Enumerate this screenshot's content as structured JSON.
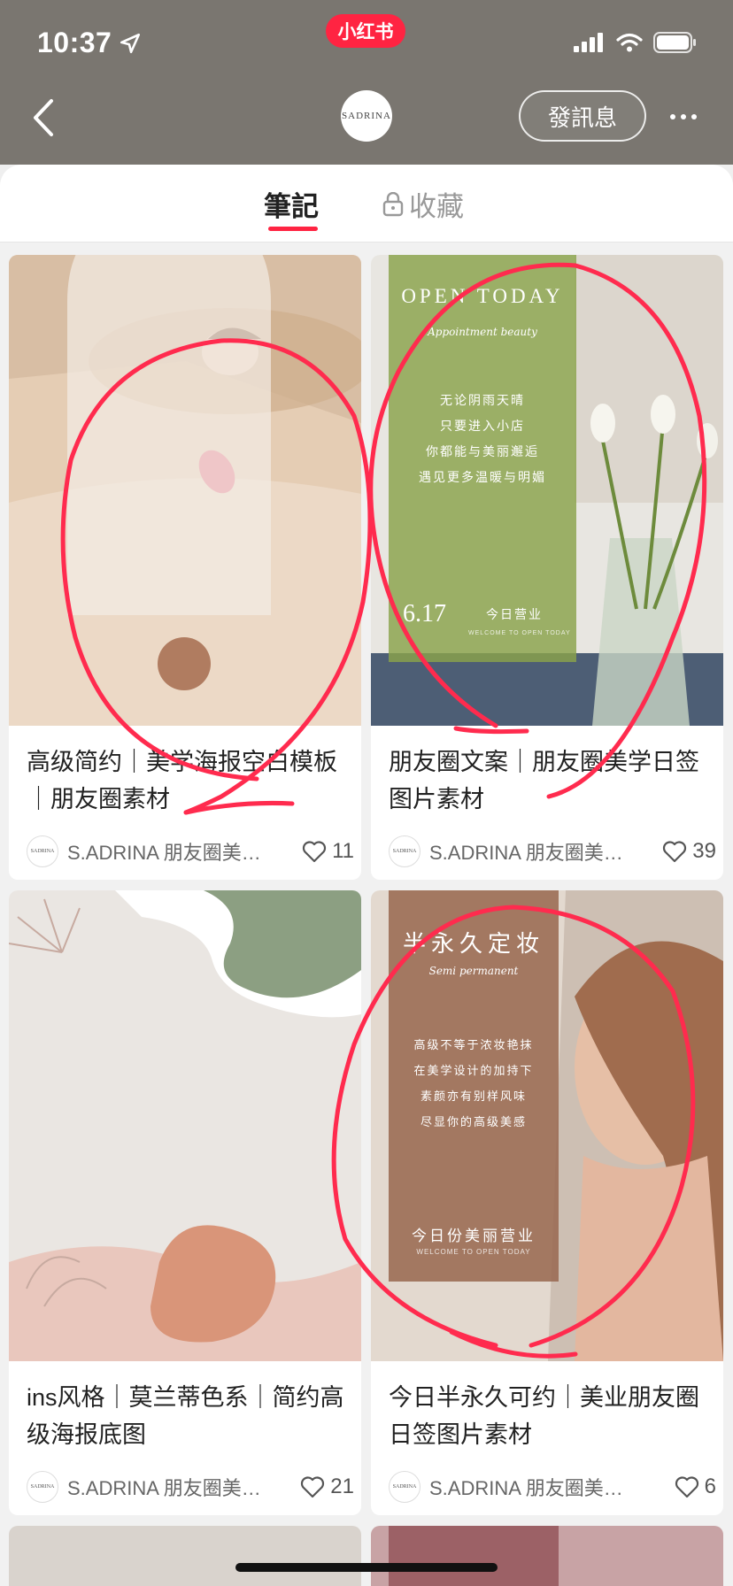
{
  "status": {
    "time": "10:37",
    "app_badge": "小红书"
  },
  "header": {
    "avatar_text": "SADRINA",
    "message_button": "發訊息"
  },
  "tabs": {
    "notes": "筆記",
    "collections": "收藏"
  },
  "cards": [
    {
      "title": "高级简约｜美学海报空白模板｜朋友圈素材",
      "author": "S.ADRINA 朋友圈美…",
      "likes": "11"
    },
    {
      "title": "朋友圈文案｜朋友圈美学日签图片素材",
      "author": "S.ADRINA 朋友圈美…",
      "likes": "39",
      "image_text": {
        "heading": "OPEN TODAY",
        "script": "Appointment beauty",
        "lines": [
          "无论阴雨天晴",
          "只要进入小店",
          "你都能与美丽邂逅",
          "遇见更多温暖与明媚"
        ],
        "date": "6.17",
        "open": "今日营业",
        "welcome": "WELCOME TO OPEN TODAY"
      }
    },
    {
      "title": "ins风格｜莫兰蒂色系｜简约高级海报底图",
      "author": "S.ADRINA 朋友圈美…",
      "likes": "21"
    },
    {
      "title": "今日半永久可约｜美业朋友圈日签图片素材",
      "author": "S.ADRINA 朋友圈美…",
      "likes": "6",
      "image_text": {
        "heading": "半永久定妆",
        "script": "Semi permanent",
        "lines": [
          "高级不等于浓妆艳抹",
          "在美学设计的加持下",
          "素颜亦有别样风味",
          "尽显你的高级美感"
        ],
        "open": "今日份美丽营业",
        "welcome": "WELCOME TO OPEN TODAY"
      }
    }
  ],
  "colors": {
    "accent": "#ff2442",
    "header_bg": "#7a7670",
    "scribble": "#ff2b4e"
  }
}
